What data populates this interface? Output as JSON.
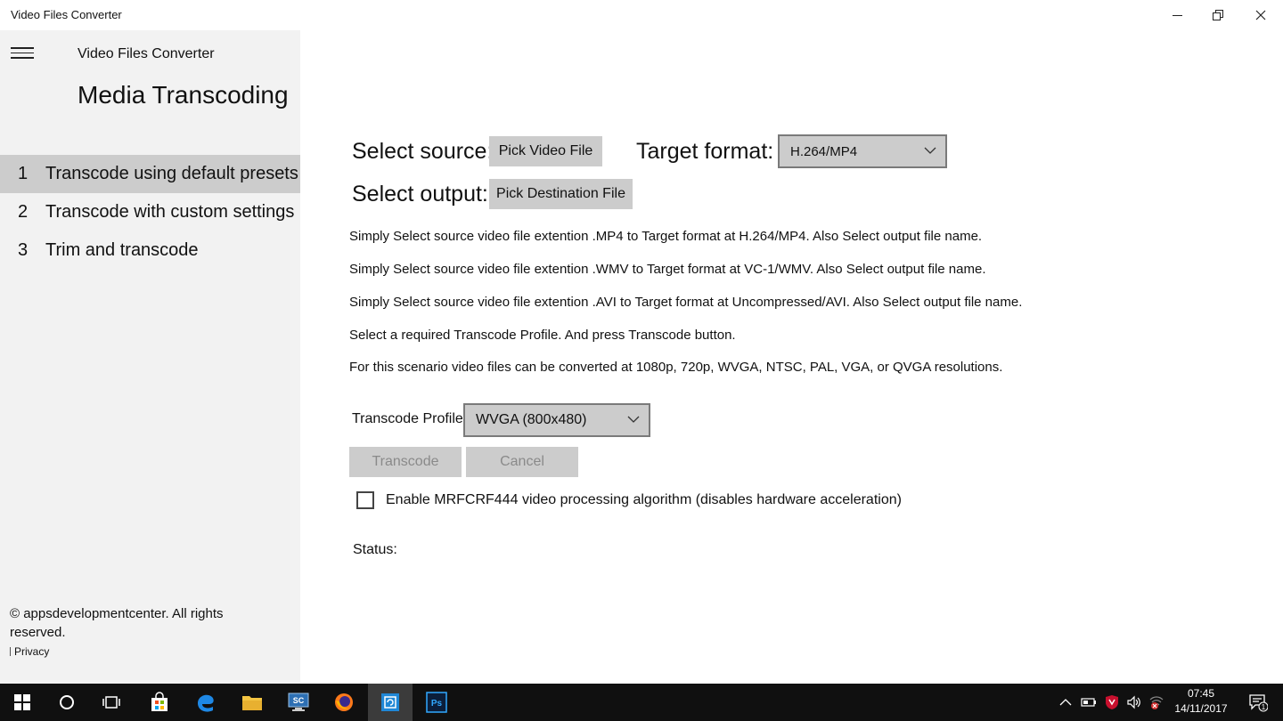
{
  "window": {
    "title": "Video Files Converter"
  },
  "sidebar": {
    "app_name": "Video Files Converter",
    "heading": "Media Transcoding",
    "items": [
      {
        "number": "1",
        "label": "Transcode using default presets",
        "active": true
      },
      {
        "number": "2",
        "label": "Transcode with custom settings",
        "active": false
      },
      {
        "number": "3",
        "label": "Trim and transcode",
        "active": false
      }
    ],
    "footer": {
      "copyright": "© appsdevelopmentcenter. All rights reserved.",
      "privacy": "Privacy"
    }
  },
  "main": {
    "select_source_label": "Select source:",
    "pick_video_button": "Pick Video File",
    "target_format_label": "Target format:",
    "target_format_value": "H.264/MP4",
    "select_output_label": "Select output:",
    "pick_destination_button": "Pick Destination File",
    "instructions": [
      "Simply Select source video file extention .MP4 to Target format at H.264/MP4. Also Select output file name.",
      "Simply Select source video file extention .WMV to Target format at VC-1/WMV. Also Select output file name.",
      "Simply Select source video file extention .AVI to Target format at Uncompressed/AVI. Also Select output file name.",
      "Select a required Transcode Profile. And press Transcode button.",
      "For this scenario video files can be converted at 1080p, 720p, WVGA, NTSC, PAL, VGA, or QVGA resolutions."
    ],
    "transcode_profile_label": "Transcode Profile",
    "transcode_profile_value": "WVGA (800x480)",
    "transcode_button": "Transcode",
    "cancel_button": "Cancel",
    "checkbox_label": "Enable MRFCRF444 video processing algorithm (disables hardware acceleration)",
    "checkbox_checked": false,
    "status_label": "Status:"
  },
  "taskbar": {
    "apps": [
      "start",
      "search",
      "task-view",
      "store",
      "edge",
      "file-explorer",
      "sc-app",
      "firefox",
      "video-converter",
      "photoshop"
    ],
    "active_app": "video-converter",
    "clock_time": "07:45",
    "clock_date": "14/11/2017",
    "notification_count": "1"
  },
  "colors": {
    "sidebar_bg": "#f2f2f2",
    "nav_active_bg": "#cccccc",
    "button_bg": "#cccccc",
    "taskbar_bg": "#101010"
  }
}
